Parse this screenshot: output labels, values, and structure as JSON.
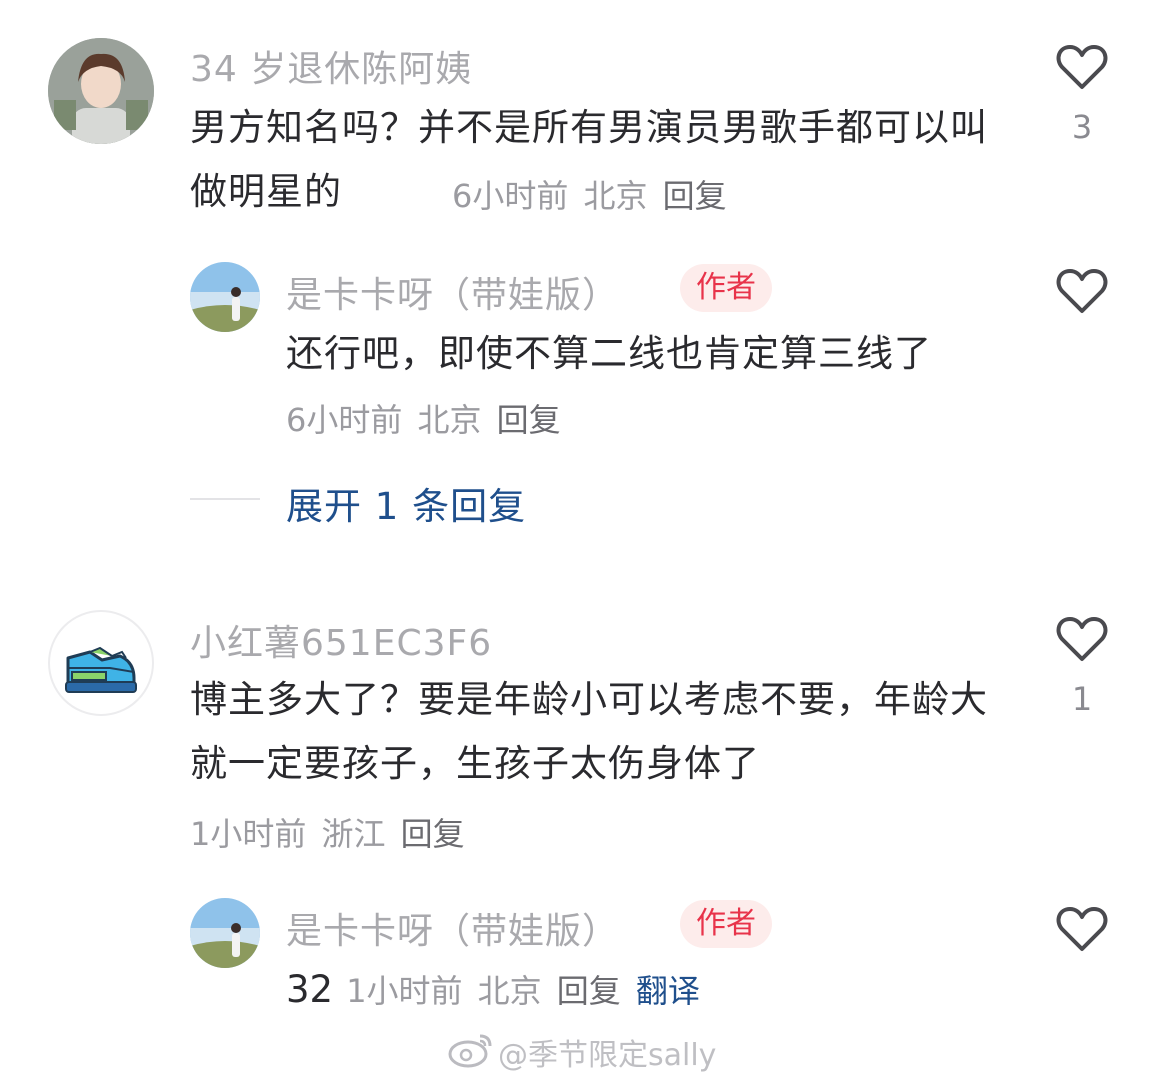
{
  "comments": [
    {
      "username": "34 岁退休陈阿姨",
      "text": "男方知名吗？并不是所有男演员男歌手都可以叫做明星的",
      "time": "6小时前",
      "location": "北京",
      "reply_label": "回复",
      "likes": "3",
      "replies": [
        {
          "username": "是卡卡呀（带娃版）",
          "badge": "作者",
          "text": "还行吧，即使不算二线也肯定算三线了",
          "time": "6小时前",
          "location": "北京",
          "reply_label": "回复"
        }
      ],
      "expand_label": "展开 1 条回复"
    },
    {
      "username": "小红薯651EC3F6",
      "text": "博主多大了？要是年龄小可以考虑不要，年龄大就一定要孩子，生孩子太伤身体了",
      "time": "1小时前",
      "location": "浙江",
      "reply_label": "回复",
      "likes": "1",
      "replies": [
        {
          "username": "是卡卡呀（带娃版）",
          "badge": "作者",
          "text": "32",
          "time": "1小时前",
          "location": "北京",
          "reply_label": "回复",
          "translate_label": "翻译"
        }
      ]
    }
  ],
  "watermark": "@季节限定sally",
  "icons": {
    "like": "heart-icon",
    "sneaker": "sneaker-icon",
    "weibo": "weibo-icon"
  },
  "colors": {
    "link": "#1f4f8c",
    "author_badge": "#e8334a",
    "username": "#a9a9ad"
  }
}
